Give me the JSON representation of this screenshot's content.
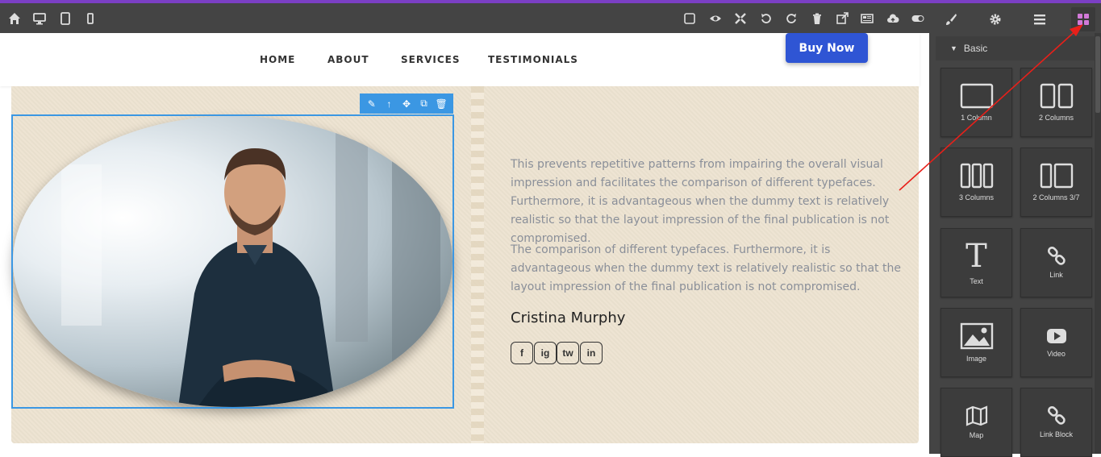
{
  "nav": {
    "items": [
      "HOME",
      "ABOUT",
      "SERVICES",
      "TESTIMONIALS"
    ],
    "cta": "Buy Now"
  },
  "profile": {
    "paragraph1": "This prevents repetitive patterns from impairing the overall visual impression and facilitates the comparison of different typefaces. Furthermore, it is advantageous when the dummy text is relatively realistic so that the layout impression of the final publication is not compromised.",
    "paragraph2": "The comparison of different typefaces. Furthermore, it is advantageous when the dummy text is relatively realistic so that the layout impression of the final publication is not compromised.",
    "name": "Cristina Murphy",
    "socials": [
      "f",
      "ig",
      "tw",
      "in"
    ]
  },
  "panel": {
    "section": "Basic",
    "blocks": [
      "1 Column",
      "2 Columns",
      "3 Columns",
      "2 Columns 3/7",
      "Text",
      "Link",
      "Image",
      "Video",
      "Map",
      "Link Block"
    ]
  },
  "colors": {
    "accent": "#2f55d4",
    "selection": "#3b97e3",
    "toolbar": "#444444",
    "paper": "#ede3d1",
    "layer_icon": "#d279d8"
  }
}
